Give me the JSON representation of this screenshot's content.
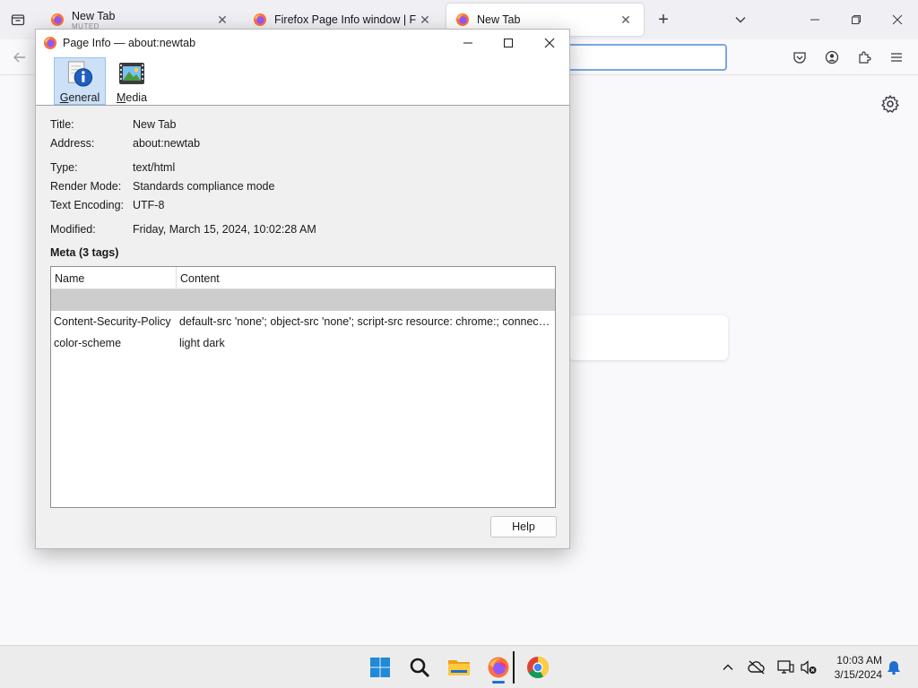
{
  "browser": {
    "tabs": [
      {
        "title": "New Tab",
        "subtitle": "MUTED",
        "active": false
      },
      {
        "title": "Firefox Page Info window | Firef",
        "subtitle": "",
        "active": false
      },
      {
        "title": "New Tab",
        "subtitle": "",
        "active": true
      }
    ],
    "new_tab_symbol": "+",
    "close_symbol": "✕"
  },
  "dialog": {
    "title": "Page Info — about:newtab",
    "panes": [
      {
        "label": "General",
        "selected": true,
        "icon": "info-icon"
      },
      {
        "label": "Media",
        "selected": false,
        "icon": "media-icon"
      }
    ],
    "fields": {
      "title_label": "Title:",
      "title_value": "New Tab",
      "address_label": "Address:",
      "address_value": "about:newtab",
      "type_label": "Type:",
      "type_value": "text/html",
      "render_label": "Render Mode:",
      "render_value": "Standards compliance mode",
      "encoding_label": "Text Encoding:",
      "encoding_value": "UTF-8",
      "modified_label": "Modified:",
      "modified_value": "Friday, March 15, 2024, 10:02:28 AM"
    },
    "meta_heading": "Meta (3 tags)",
    "meta_table": {
      "columns": [
        "Name",
        "Content"
      ],
      "rows": [
        {
          "name": "",
          "content": "",
          "selected": true
        },
        {
          "name": "Content-Security-Policy",
          "content": "default-src 'none'; object-src 'none'; script-src resource: chrome:; connect-src https:",
          "selected": false
        },
        {
          "name": "color-scheme",
          "content": "light dark",
          "selected": false
        }
      ]
    },
    "help_label": "Help"
  },
  "taskbar": {
    "apps": [
      "start-icon",
      "search-icon",
      "file-explorer-icon",
      "firefox-icon",
      "chrome-icon"
    ],
    "time": "10:03 AM",
    "date": "3/15/2024"
  },
  "colors": {
    "accent": "#1f6fd1",
    "selection": "#cce0f7",
    "firefox_orange": "#ff7139"
  }
}
